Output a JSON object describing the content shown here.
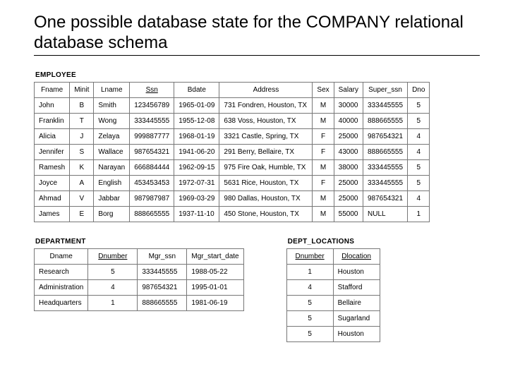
{
  "title": "One possible database state for the COMPANY relational database schema",
  "employee": {
    "label": "EMPLOYEE",
    "headers": [
      "Fname",
      "Minit",
      "Lname",
      "Ssn",
      "Bdate",
      "Address",
      "Sex",
      "Salary",
      "Super_ssn",
      "Dno"
    ],
    "pk_index": 3,
    "rows": [
      [
        "John",
        "B",
        "Smith",
        "123456789",
        "1965-01-09",
        "731 Fondren, Houston, TX",
        "M",
        "30000",
        "333445555",
        "5"
      ],
      [
        "Franklin",
        "T",
        "Wong",
        "333445555",
        "1955-12-08",
        "638 Voss, Houston, TX",
        "M",
        "40000",
        "888665555",
        "5"
      ],
      [
        "Alicia",
        "J",
        "Zelaya",
        "999887777",
        "1968-01-19",
        "3321 Castle, Spring, TX",
        "F",
        "25000",
        "987654321",
        "4"
      ],
      [
        "Jennifer",
        "S",
        "Wallace",
        "987654321",
        "1941-06-20",
        "291 Berry, Bellaire, TX",
        "F",
        "43000",
        "888665555",
        "4"
      ],
      [
        "Ramesh",
        "K",
        "Narayan",
        "666884444",
        "1962-09-15",
        "975 Fire Oak, Humble, TX",
        "M",
        "38000",
        "333445555",
        "5"
      ],
      [
        "Joyce",
        "A",
        "English",
        "453453453",
        "1972-07-31",
        "5631 Rice, Houston, TX",
        "F",
        "25000",
        "333445555",
        "5"
      ],
      [
        "Ahmad",
        "V",
        "Jabbar",
        "987987987",
        "1969-03-29",
        "980 Dallas, Houston, TX",
        "M",
        "25000",
        "987654321",
        "4"
      ],
      [
        "James",
        "E",
        "Borg",
        "888665555",
        "1937-11-10",
        "450 Stone, Houston, TX",
        "M",
        "55000",
        "NULL",
        "1"
      ]
    ]
  },
  "department": {
    "label": "DEPARTMENT",
    "headers": [
      "Dname",
      "Dnumber",
      "Mgr_ssn",
      "Mgr_start_date"
    ],
    "pk_index": 1,
    "rows": [
      [
        "Research",
        "5",
        "333445555",
        "1988-05-22"
      ],
      [
        "Administration",
        "4",
        "987654321",
        "1995-01-01"
      ],
      [
        "Headquarters",
        "1",
        "888665555",
        "1981-06-19"
      ]
    ]
  },
  "dept_locations": {
    "label": "DEPT_LOCATIONS",
    "headers": [
      "Dnumber",
      "Dlocation"
    ],
    "pk_index": -1,
    "pk_both": true,
    "rows": [
      [
        "1",
        "Houston"
      ],
      [
        "4",
        "Stafford"
      ],
      [
        "5",
        "Bellaire"
      ],
      [
        "5",
        "Sugarland"
      ],
      [
        "5",
        "Houston"
      ]
    ]
  }
}
